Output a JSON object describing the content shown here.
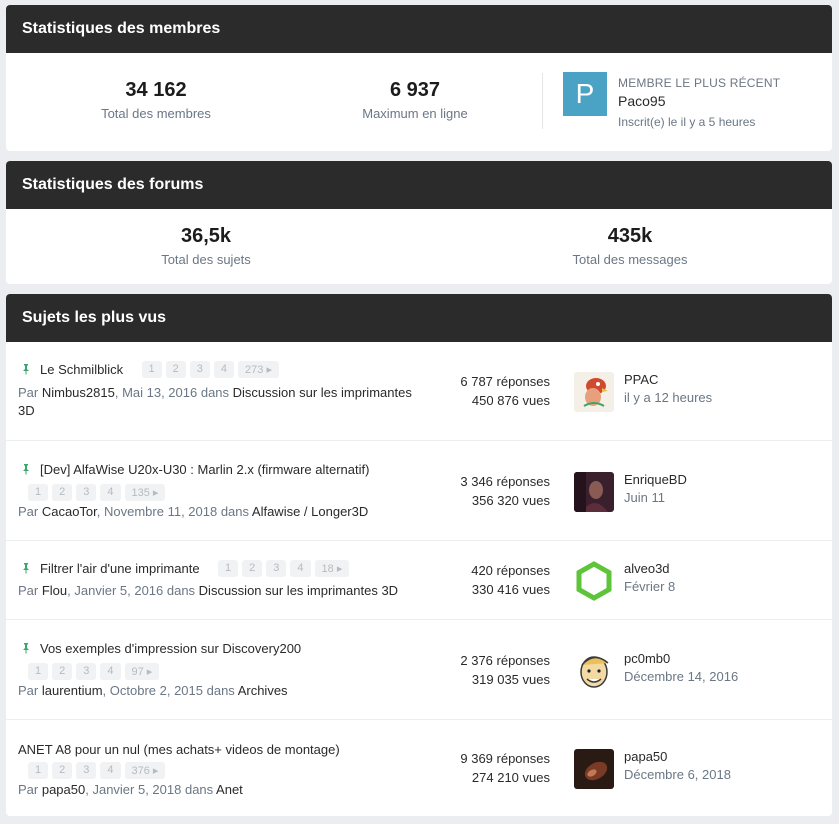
{
  "members": {
    "title": "Statistiques des membres",
    "total_value": "34 162",
    "total_label": "Total des membres",
    "max_value": "6 937",
    "max_label": "Maximum en ligne",
    "newest_caption": "MEMBRE LE PLUS RÉCENT",
    "newest_name": "Paco95",
    "newest_letter": "P",
    "newest_when": "Inscrit(e) le il y a 5 heures"
  },
  "forums": {
    "title": "Statistiques des forums",
    "topics_value": "36,5k",
    "topics_label": "Total des sujets",
    "posts_value": "435k",
    "posts_label": "Total des messages"
  },
  "popular": {
    "title": "Sujets les plus vus",
    "topics": [
      {
        "title": "Le Schmilblick",
        "pages": [
          "1",
          "2",
          "3",
          "4",
          "273 ▸"
        ],
        "by": "Par ",
        "author": "Nimbus2815",
        "date": ", Mai 13, 2016 dans ",
        "forum_line1": "Discussion sur les imprimantes",
        "forum_line2": "3D",
        "replies": "6 787 réponses",
        "views": "450 876 vues",
        "last_user": "PPAC",
        "last_when": "il y a 12 heures"
      },
      {
        "title": "[Dev] AlfaWise U20x-U30 : Marlin 2.x (firmware alternatif)",
        "pages": [
          "1",
          "2",
          "3",
          "4",
          "135 ▸"
        ],
        "by": "Par ",
        "author": "CacaoTor",
        "date": ", Novembre 11, 2018 dans ",
        "forum": "Alfawise / Longer3D",
        "replies": "3 346 réponses",
        "views": "356 320 vues",
        "last_user": "EnriqueBD",
        "last_when": "Juin 11"
      },
      {
        "title": "Filtrer l'air d'une imprimante",
        "pages": [
          "1",
          "2",
          "3",
          "4",
          "18 ▸"
        ],
        "by": "Par ",
        "author": "Flou",
        "date": ", Janvier 5, 2016 dans ",
        "forum": "Discussion sur les imprimantes 3D",
        "replies": "420 réponses",
        "views": "330 416 vues",
        "last_user": "alveo3d",
        "last_when": "Février 8"
      },
      {
        "title": "Vos exemples d'impression sur Discovery200",
        "pages": [
          "1",
          "2",
          "3",
          "4",
          "97 ▸"
        ],
        "by": "Par ",
        "author": "laurentium",
        "date": ", Octobre 2, 2015 dans ",
        "forum": "Archives",
        "replies": "2 376 réponses",
        "views": "319 035 vues",
        "last_user": "pc0mb0",
        "last_when": "Décembre 14, 2016"
      },
      {
        "title": "ANET A8 pour un nul (mes achats+ videos de montage)",
        "pages": [
          "1",
          "2",
          "3",
          "4",
          "376 ▸"
        ],
        "by": "Par ",
        "author": "papa50",
        "date": ", Janvier 5, 2018 dans ",
        "forum": "Anet",
        "replies": "9 369 réponses",
        "views": "274 210 vues",
        "last_user": "papa50",
        "last_when": "Décembre 6, 2018"
      }
    ]
  },
  "colors": {
    "header_bg": "#2b2b2b",
    "accent_pin": "#3aa66e",
    "muted": "#6b7785",
    "avatar_p": "#4aa2c4"
  }
}
